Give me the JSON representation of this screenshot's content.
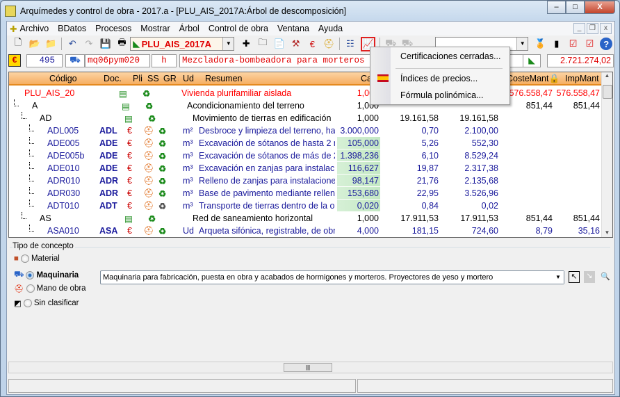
{
  "window": {
    "title": "Arquímedes y control de obra - 2017.a - [PLU_AIS_2017A:Árbol de descomposición]",
    "min": "–",
    "max": "□",
    "close": "X"
  },
  "menubar": {
    "items": [
      "Archivo",
      "BDatos",
      "Procesos",
      "Mostrar",
      "Árbol",
      "Control de obra",
      "Ventana",
      "Ayuda"
    ]
  },
  "toolbar": {
    "project_combo": "PLU_AIS_2017A",
    "second_combo": ""
  },
  "infobar": {
    "count": "495",
    "code": "mq06pym020",
    "unit": "h",
    "description": "Mezcladora-bombeadora para morteros au",
    "total": "2.721.274,02"
  },
  "columns": {
    "codigo": "Código",
    "doc": "Doc.",
    "pli": "Pli",
    "ss": "SS",
    "gr": "GR",
    "ud": "Ud",
    "resumen": "Resumen",
    "cant": "Cant.",
    "costemant": "CosteMant🔒",
    "impmant": "ImpMant"
  },
  "rows": [
    {
      "level": 0,
      "type": "root",
      "code": "PLU_AIS_20",
      "doc": "",
      "ud": "",
      "resumen": "Vivienda plurifamiliar aislada",
      "cant": "1,000",
      "precio": "",
      "importe": "",
      "costemant": "576.558,47",
      "impmant": "576.558,47"
    },
    {
      "level": 1,
      "type": "chapter",
      "code": "A",
      "doc": "",
      "ud": "",
      "resumen": "Acondicionamiento del terreno",
      "cant": "1,000",
      "precio": "",
      "importe": "",
      "costemant": "851,44",
      "impmant": "851,44"
    },
    {
      "level": 2,
      "type": "chapter",
      "code": "AD",
      "doc": "",
      "ud": "",
      "resumen": "Movimiento de tierras en edificación",
      "cant": "1,000",
      "precio": "19.161,58",
      "importe": "19.161,58",
      "costemant": "",
      "impmant": ""
    },
    {
      "level": 3,
      "type": "item",
      "code": "ADL005",
      "doc": "ADL",
      "ud": "m²",
      "resumen": "Desbroce y limpieza del terreno, ha",
      "cant": "3.000,000",
      "precio": "0,70",
      "importe": "2.100,00",
      "costemant": "",
      "impmant": "",
      "green": false
    },
    {
      "level": 3,
      "type": "item",
      "code": "ADE005",
      "doc": "ADE",
      "ud": "m³",
      "resumen": "Excavación de sótanos de hasta 2 m",
      "cant": "105,000",
      "precio": "5,26",
      "importe": "552,30",
      "costemant": "",
      "impmant": "",
      "green": true
    },
    {
      "level": 3,
      "type": "item",
      "code": "ADE005b",
      "doc": "ADE",
      "ud": "m³",
      "resumen": "Excavación de sótanos de más de 2",
      "cant": "1.398,236",
      "precio": "6,10",
      "importe": "8.529,24",
      "costemant": "",
      "impmant": "",
      "green": true
    },
    {
      "level": 3,
      "type": "item",
      "code": "ADE010",
      "doc": "ADE",
      "ud": "m³",
      "resumen": "Excavación en zanjas para instalaci",
      "cant": "116,627",
      "precio": "19,87",
      "importe": "2.317,38",
      "costemant": "",
      "impmant": "",
      "green": true
    },
    {
      "level": 3,
      "type": "item",
      "code": "ADR010",
      "doc": "ADR",
      "ud": "m³",
      "resumen": "Relleno de zanjas para instalacione",
      "cant": "98,147",
      "precio": "21,76",
      "importe": "2.135,68",
      "costemant": "",
      "impmant": "",
      "green": true
    },
    {
      "level": 3,
      "type": "item",
      "code": "ADR030",
      "doc": "ADR",
      "ud": "m³",
      "resumen": "Base de pavimento mediante rellen",
      "cant": "153,680",
      "precio": "22,95",
      "importe": "3.526,96",
      "costemant": "",
      "impmant": "",
      "green": true
    },
    {
      "level": 3,
      "type": "item",
      "code": "ADT010",
      "doc": "ADT",
      "ud": "m³",
      "resumen": "Transporte de tierras dentro de la o",
      "cant": "0,020",
      "precio": "0,84",
      "importe": "0,02",
      "costemant": "",
      "impmant": "",
      "green": true
    },
    {
      "level": 2,
      "type": "chapter",
      "code": "AS",
      "doc": "",
      "ud": "",
      "resumen": "Red de saneamiento horizontal",
      "cant": "1,000",
      "precio": "17.911,53",
      "importe": "17.911,53",
      "costemant": "851,44",
      "impmant": "851,44"
    },
    {
      "level": 3,
      "type": "item",
      "code": "ASA010",
      "doc": "ASA",
      "ud": "Ud",
      "resumen": "Arqueta sifónica, registrable, de obr",
      "cant": "4,000",
      "precio": "181,15",
      "importe": "724,60",
      "costemant": "8,79",
      "impmant": "35,16",
      "green": false
    }
  ],
  "dropdown_menu": {
    "items": [
      "Certificaciones cerradas...",
      "Índices de precios...",
      "Fórmula polinómica..."
    ]
  },
  "concept_panel": {
    "legend": "Tipo de concepto",
    "options": [
      "Material",
      "Maquinaria",
      "Mano de obra",
      "Sin clasificar"
    ],
    "selected": "Maquinaria",
    "category": "Maquinaria para fabricación, puesta en obra y acabados de hormigones y morteros. Proyectores de yeso y mortero"
  },
  "colors": {
    "header": "#f6ae62",
    "red": "#ff0000",
    "navy": "#1a1a9c",
    "green_cell": "#d6f0d6",
    "highlight": "#e02020"
  }
}
